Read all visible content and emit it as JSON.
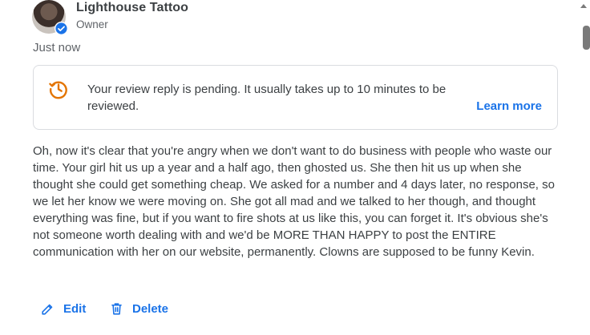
{
  "owner": {
    "name": "Lighthouse Tattoo",
    "role": "Owner",
    "avatar_icon": "avatar-photo",
    "badge_icon": "verified-check-icon"
  },
  "timestamp": "Just now",
  "notice": {
    "icon": "pending-clock-icon",
    "message": "Your review reply is pending. It usually takes up to 10 minutes to be reviewed.",
    "link_label": "Learn more"
  },
  "reply_text": "Oh, now it's clear that you're angry when we don't want to do business with people who waste our time. Your girl hit us up a year and a half ago, then ghosted us. She then hit us up when she thought she could get something cheap. We asked for a number and 4 days later, no response, so we let her know we were moving on. She got all mad and we talked to her though, and thought everything was fine, but if you want to fire shots at us like this, you can forget it. It's obvious she's not someone worth dealing with and we'd be MORE THAN HAPPY to post the ENTIRE communication with her on our website, permanently. Clowns are supposed to be funny Kevin.",
  "actions": {
    "edit_label": "Edit",
    "delete_label": "Delete"
  },
  "colors": {
    "accent": "#1a73e8",
    "pending": "#e37400",
    "text": "#3c4043",
    "muted": "#5f6368"
  }
}
